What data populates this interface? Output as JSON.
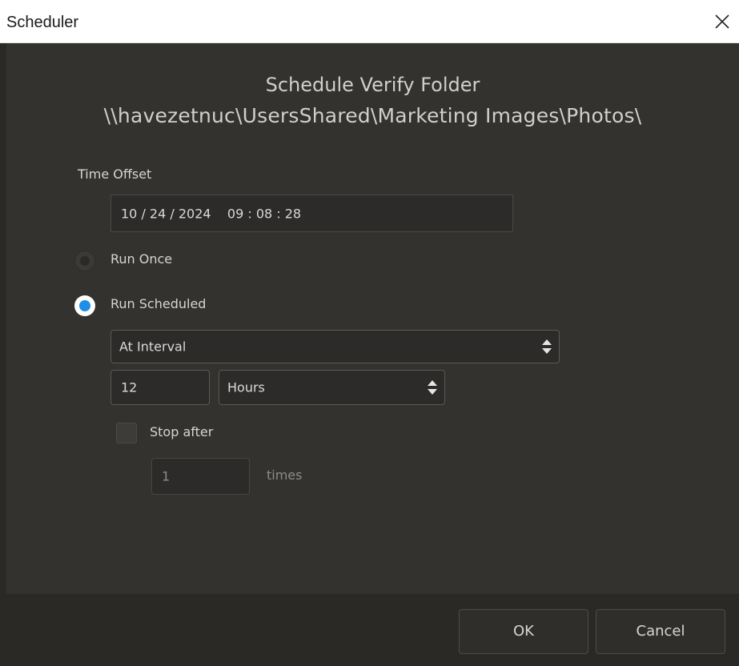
{
  "window": {
    "title": "Scheduler"
  },
  "header": {
    "title": "Schedule Verify Folder",
    "path": "\\\\havezetnuc\\UsersShared\\Marketing Images\\Photos\\"
  },
  "time_offset": {
    "label": "Time Offset",
    "value": "10 / 24 / 2024    09 : 08 : 28"
  },
  "mode": {
    "run_once_label": "Run Once",
    "run_once_selected": false,
    "run_scheduled_label": "Run Scheduled",
    "run_scheduled_selected": true
  },
  "schedule": {
    "type_value": "At Interval",
    "interval_value": "12",
    "unit_value": "Hours"
  },
  "stop_after": {
    "label": "Stop after",
    "checked": false,
    "count_value": "1",
    "times_label": "times"
  },
  "footer": {
    "ok_label": "OK",
    "cancel_label": "Cancel"
  },
  "colors": {
    "background": "#33322f",
    "footer": "#2a2926",
    "accent": "#1e8ee6"
  },
  "icons": {
    "close": "close-icon",
    "select_arrows": "up-down-arrows-icon"
  }
}
